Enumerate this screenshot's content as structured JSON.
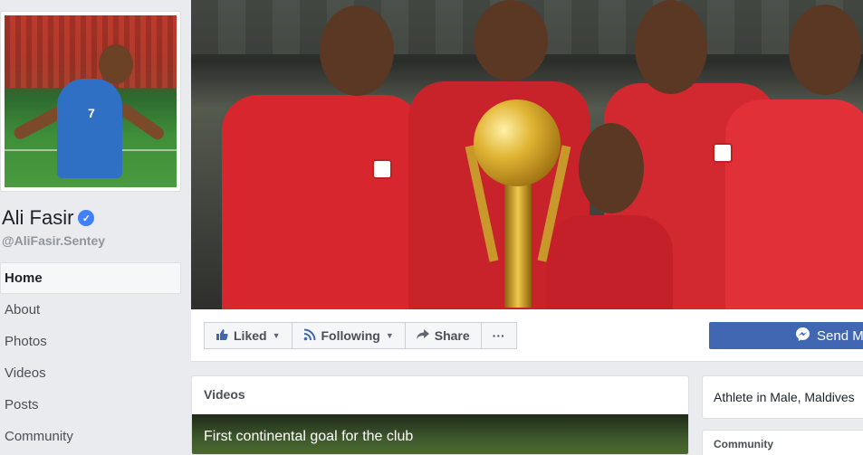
{
  "profile": {
    "name": "Ali Fasir",
    "verified_mark": "✓",
    "handle": "@AliFasir.Sentey",
    "jersey_number": "7"
  },
  "nav": {
    "items": [
      {
        "label": "Home",
        "active": true
      },
      {
        "label": "About"
      },
      {
        "label": "Photos"
      },
      {
        "label": "Videos"
      },
      {
        "label": "Posts"
      },
      {
        "label": "Community"
      }
    ]
  },
  "actions": {
    "liked": "Liked",
    "following": "Following",
    "share": "Share",
    "more": "···",
    "send_message": "Send M"
  },
  "videos": {
    "title": "Videos",
    "caption": "First continental goal for the club"
  },
  "about": {
    "text": "Athlete in Male, Maldives"
  },
  "community": {
    "title": "Community"
  },
  "colors": {
    "brand_blue": "#4267b2",
    "verified_blue": "#4080ff",
    "page_bg": "#e9ebee"
  },
  "icons": [
    "verified-icon",
    "thumbs-up-icon",
    "rss-icon",
    "share-arrow-icon",
    "more-dots-icon",
    "messenger-icon",
    "caret-down-icon"
  ]
}
